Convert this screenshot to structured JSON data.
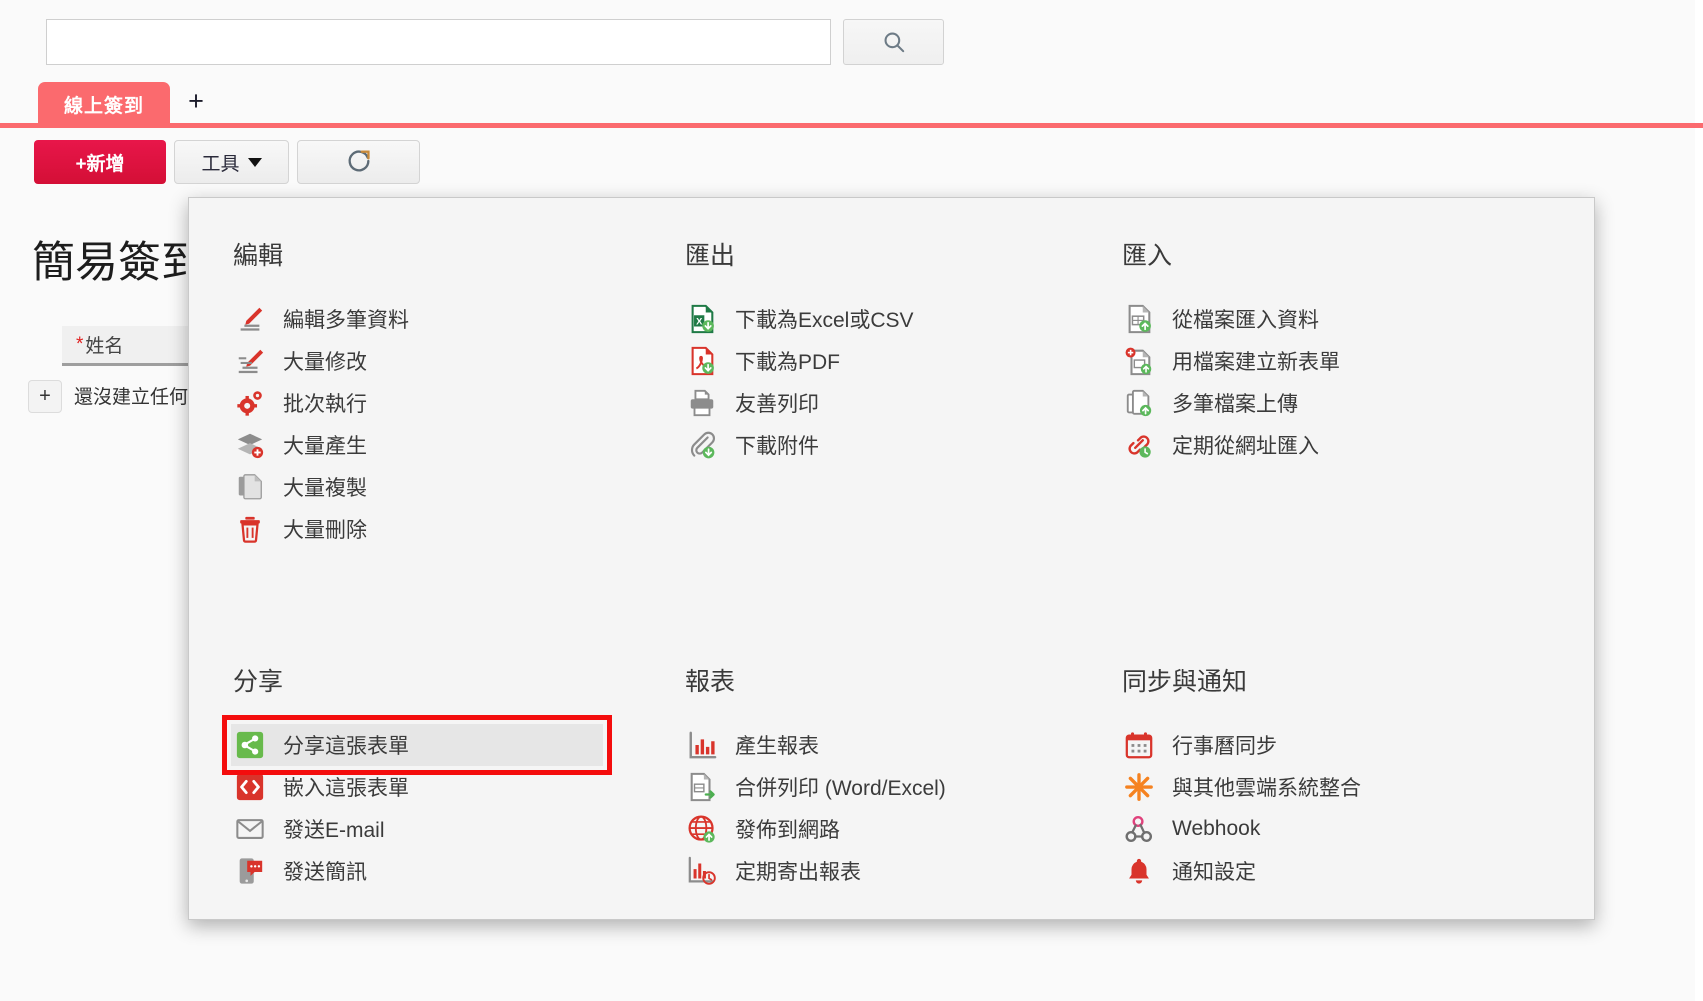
{
  "search": {
    "value": "",
    "placeholder": "",
    "button_icon": "search-icon"
  },
  "tabs": {
    "items": [
      {
        "label": "線上簽到",
        "active": true
      }
    ],
    "add_label": "+"
  },
  "toolbar": {
    "add_label": "+新增",
    "tools_label": "工具",
    "refresh_icon": "refresh-icon"
  },
  "page": {
    "title": "簡易簽到表",
    "grid_header": {
      "required_mark": "*",
      "label": "姓名"
    },
    "row_add_label": "+",
    "empty_text": "還沒建立任何資料"
  },
  "menu": {
    "blocks": [
      {
        "title": "編輯",
        "items": [
          {
            "label": "編輯多筆資料",
            "icon": "pencil-lines-icon"
          },
          {
            "label": "大量修改",
            "icon": "pencil-bulk-icon"
          },
          {
            "label": "批次執行",
            "icon": "gears-icon"
          },
          {
            "label": "大量產生",
            "icon": "layers-plus-icon"
          },
          {
            "label": "大量複製",
            "icon": "copy-pages-icon"
          },
          {
            "label": "大量刪除",
            "icon": "trash-icon"
          }
        ]
      },
      {
        "title": "匯出",
        "items": [
          {
            "label": "下載為Excel或CSV",
            "icon": "excel-download-icon"
          },
          {
            "label": "下載為PDF",
            "icon": "pdf-download-icon"
          },
          {
            "label": "友善列印",
            "icon": "printer-icon"
          },
          {
            "label": "下載附件",
            "icon": "paperclip-download-icon"
          }
        ]
      },
      {
        "title": "匯入",
        "items": [
          {
            "label": "從檔案匯入資料",
            "icon": "file-upload-icon"
          },
          {
            "label": "用檔案建立新表單",
            "icon": "file-new-form-icon"
          },
          {
            "label": "多筆檔案上傳",
            "icon": "multi-file-upload-icon"
          },
          {
            "label": "定期從網址匯入",
            "icon": "link-schedule-icon"
          }
        ]
      },
      {
        "title": "分享",
        "items": [
          {
            "label": "分享這張表單",
            "icon": "share-icon",
            "highlighted": true
          },
          {
            "label": "嵌入這張表單",
            "icon": "embed-code-icon"
          },
          {
            "label": "發送E-mail",
            "icon": "envelope-icon"
          },
          {
            "label": "發送簡訊",
            "icon": "sms-icon"
          }
        ]
      },
      {
        "title": "報表",
        "items": [
          {
            "label": "產生報表",
            "icon": "bar-chart-icon"
          },
          {
            "label": "合併列印 (Word/Excel)",
            "icon": "file-merge-icon"
          },
          {
            "label": "發佈到網路",
            "icon": "globe-publish-icon"
          },
          {
            "label": "定期寄出報表",
            "icon": "chart-schedule-icon"
          }
        ]
      },
      {
        "title": "同步與通知",
        "items": [
          {
            "label": "行事曆同步",
            "icon": "calendar-icon"
          },
          {
            "label": "與其他雲端系統整合",
            "icon": "asterisk-burst-icon"
          },
          {
            "label": "Webhook",
            "icon": "webhook-icon"
          },
          {
            "label": "通知設定",
            "icon": "bell-icon"
          }
        ]
      }
    ]
  },
  "colors": {
    "tab_active": "#fb6a6e",
    "add_button": "#e0123c",
    "highlight_outline": "#f40d0d",
    "accent_red": "#d9342b",
    "green": "#5cb85c",
    "orange": "#f58220"
  }
}
